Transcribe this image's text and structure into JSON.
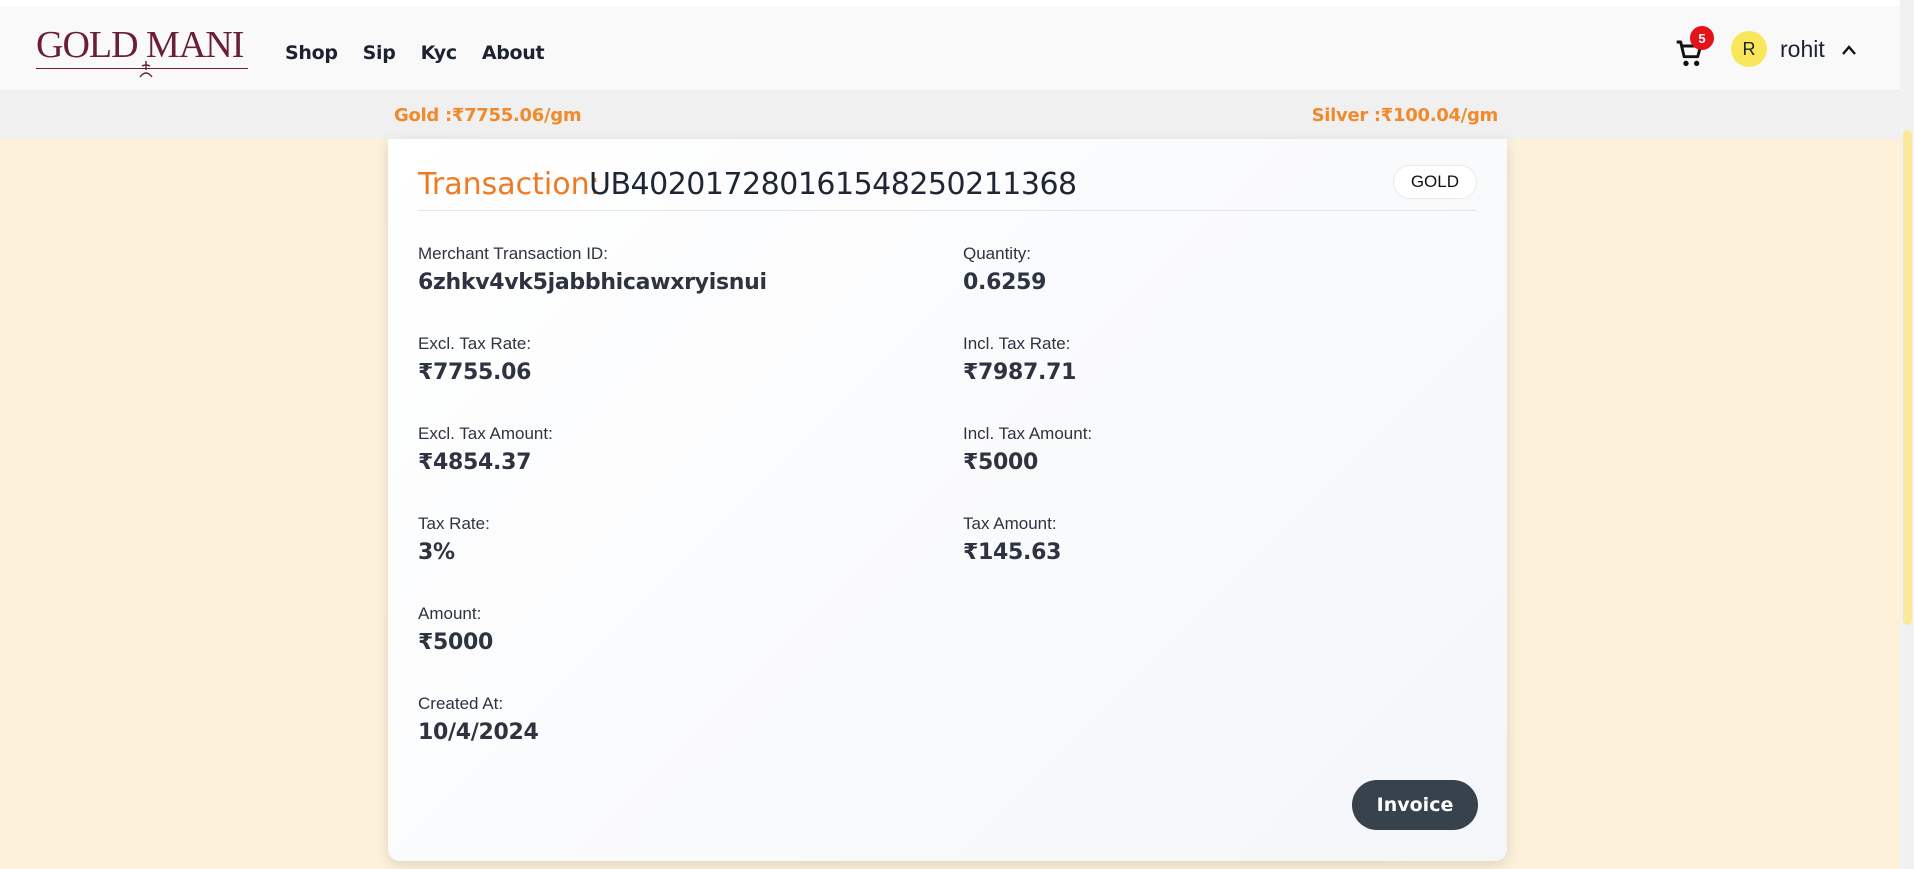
{
  "brand": {
    "logo_text": "GOLD MANI"
  },
  "nav": {
    "links": [
      "Shop",
      "Sip",
      "Kyc",
      "About"
    ]
  },
  "user": {
    "cart_count": "5",
    "avatar_initial": "R",
    "name": "rohit"
  },
  "prices": {
    "gold": "Gold :₹7755.06/gm",
    "silver": "Silver :₹100.04/gm"
  },
  "transaction": {
    "label": "Transaction:",
    "id": "UB402017280161548250211368",
    "metal_tag": "GOLD",
    "fields": [
      {
        "label": "Merchant Transaction ID:",
        "value": "6zhkv4vk5jabbhicawxryisnui"
      },
      {
        "label": "Quantity:",
        "value": "0.6259"
      },
      {
        "label": "Excl. Tax Rate:",
        "value": "₹7755.06"
      },
      {
        "label": "Incl. Tax Rate:",
        "value": "₹7987.71"
      },
      {
        "label": "Excl. Tax Amount:",
        "value": "₹4854.37"
      },
      {
        "label": "Incl. Tax Amount:",
        "value": "₹5000"
      },
      {
        "label": "Tax Rate:",
        "value": "3%"
      },
      {
        "label": "Tax Amount:",
        "value": "₹145.63"
      },
      {
        "label": "Amount:",
        "value": "₹5000"
      },
      {
        "label": "Created At:",
        "value": "10/4/2024"
      }
    ],
    "invoice_label": "Invoice"
  },
  "colors": {
    "accent": "#f07a23",
    "page_bg": "#fdf1da",
    "button": "#37424c",
    "badge": "#e3121b",
    "avatar": "#f9e65a",
    "brand": "#6b1e3a"
  }
}
